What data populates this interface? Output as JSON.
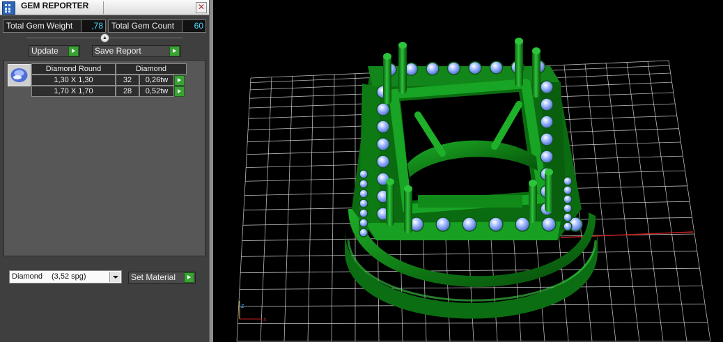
{
  "panel": {
    "title": "GEM REPORTER",
    "close_glyph": "✕",
    "total_weight_label": "Total Gem Weight",
    "total_weight_value": ",78",
    "total_count_label": "Total Gem Count",
    "total_count_value": "60",
    "update_label": "Update",
    "save_report_label": "Save Report",
    "table": {
      "headers": [
        "Diamond Round",
        "Diamond"
      ],
      "rows": [
        {
          "size": "1,30 X 1,30",
          "count": "32",
          "weight": "0,26tw"
        },
        {
          "size": "1,70 X 1,70",
          "count": "28",
          "weight": "0,52tw"
        }
      ]
    },
    "material": {
      "name": "Diamond",
      "density": "(3,52 spg)"
    },
    "set_material_label": "Set Material"
  },
  "viewport": {
    "axis_labels": {
      "z": "z",
      "x": "x"
    },
    "model": "ring-with-halo-settings"
  },
  "colors": {
    "model_green": "#0f7a14",
    "gem_blue": "#9ab6ff",
    "grid": "#d8d8d8",
    "x_axis": "#c82020",
    "z_axis": "#2ab8c8"
  },
  "icons": {
    "app": "gem-reporter-icon",
    "close": "close-icon",
    "thumb": "diamond-round-icon",
    "play": "play-arrow-icon",
    "dropdown": "chevron-down-icon"
  }
}
